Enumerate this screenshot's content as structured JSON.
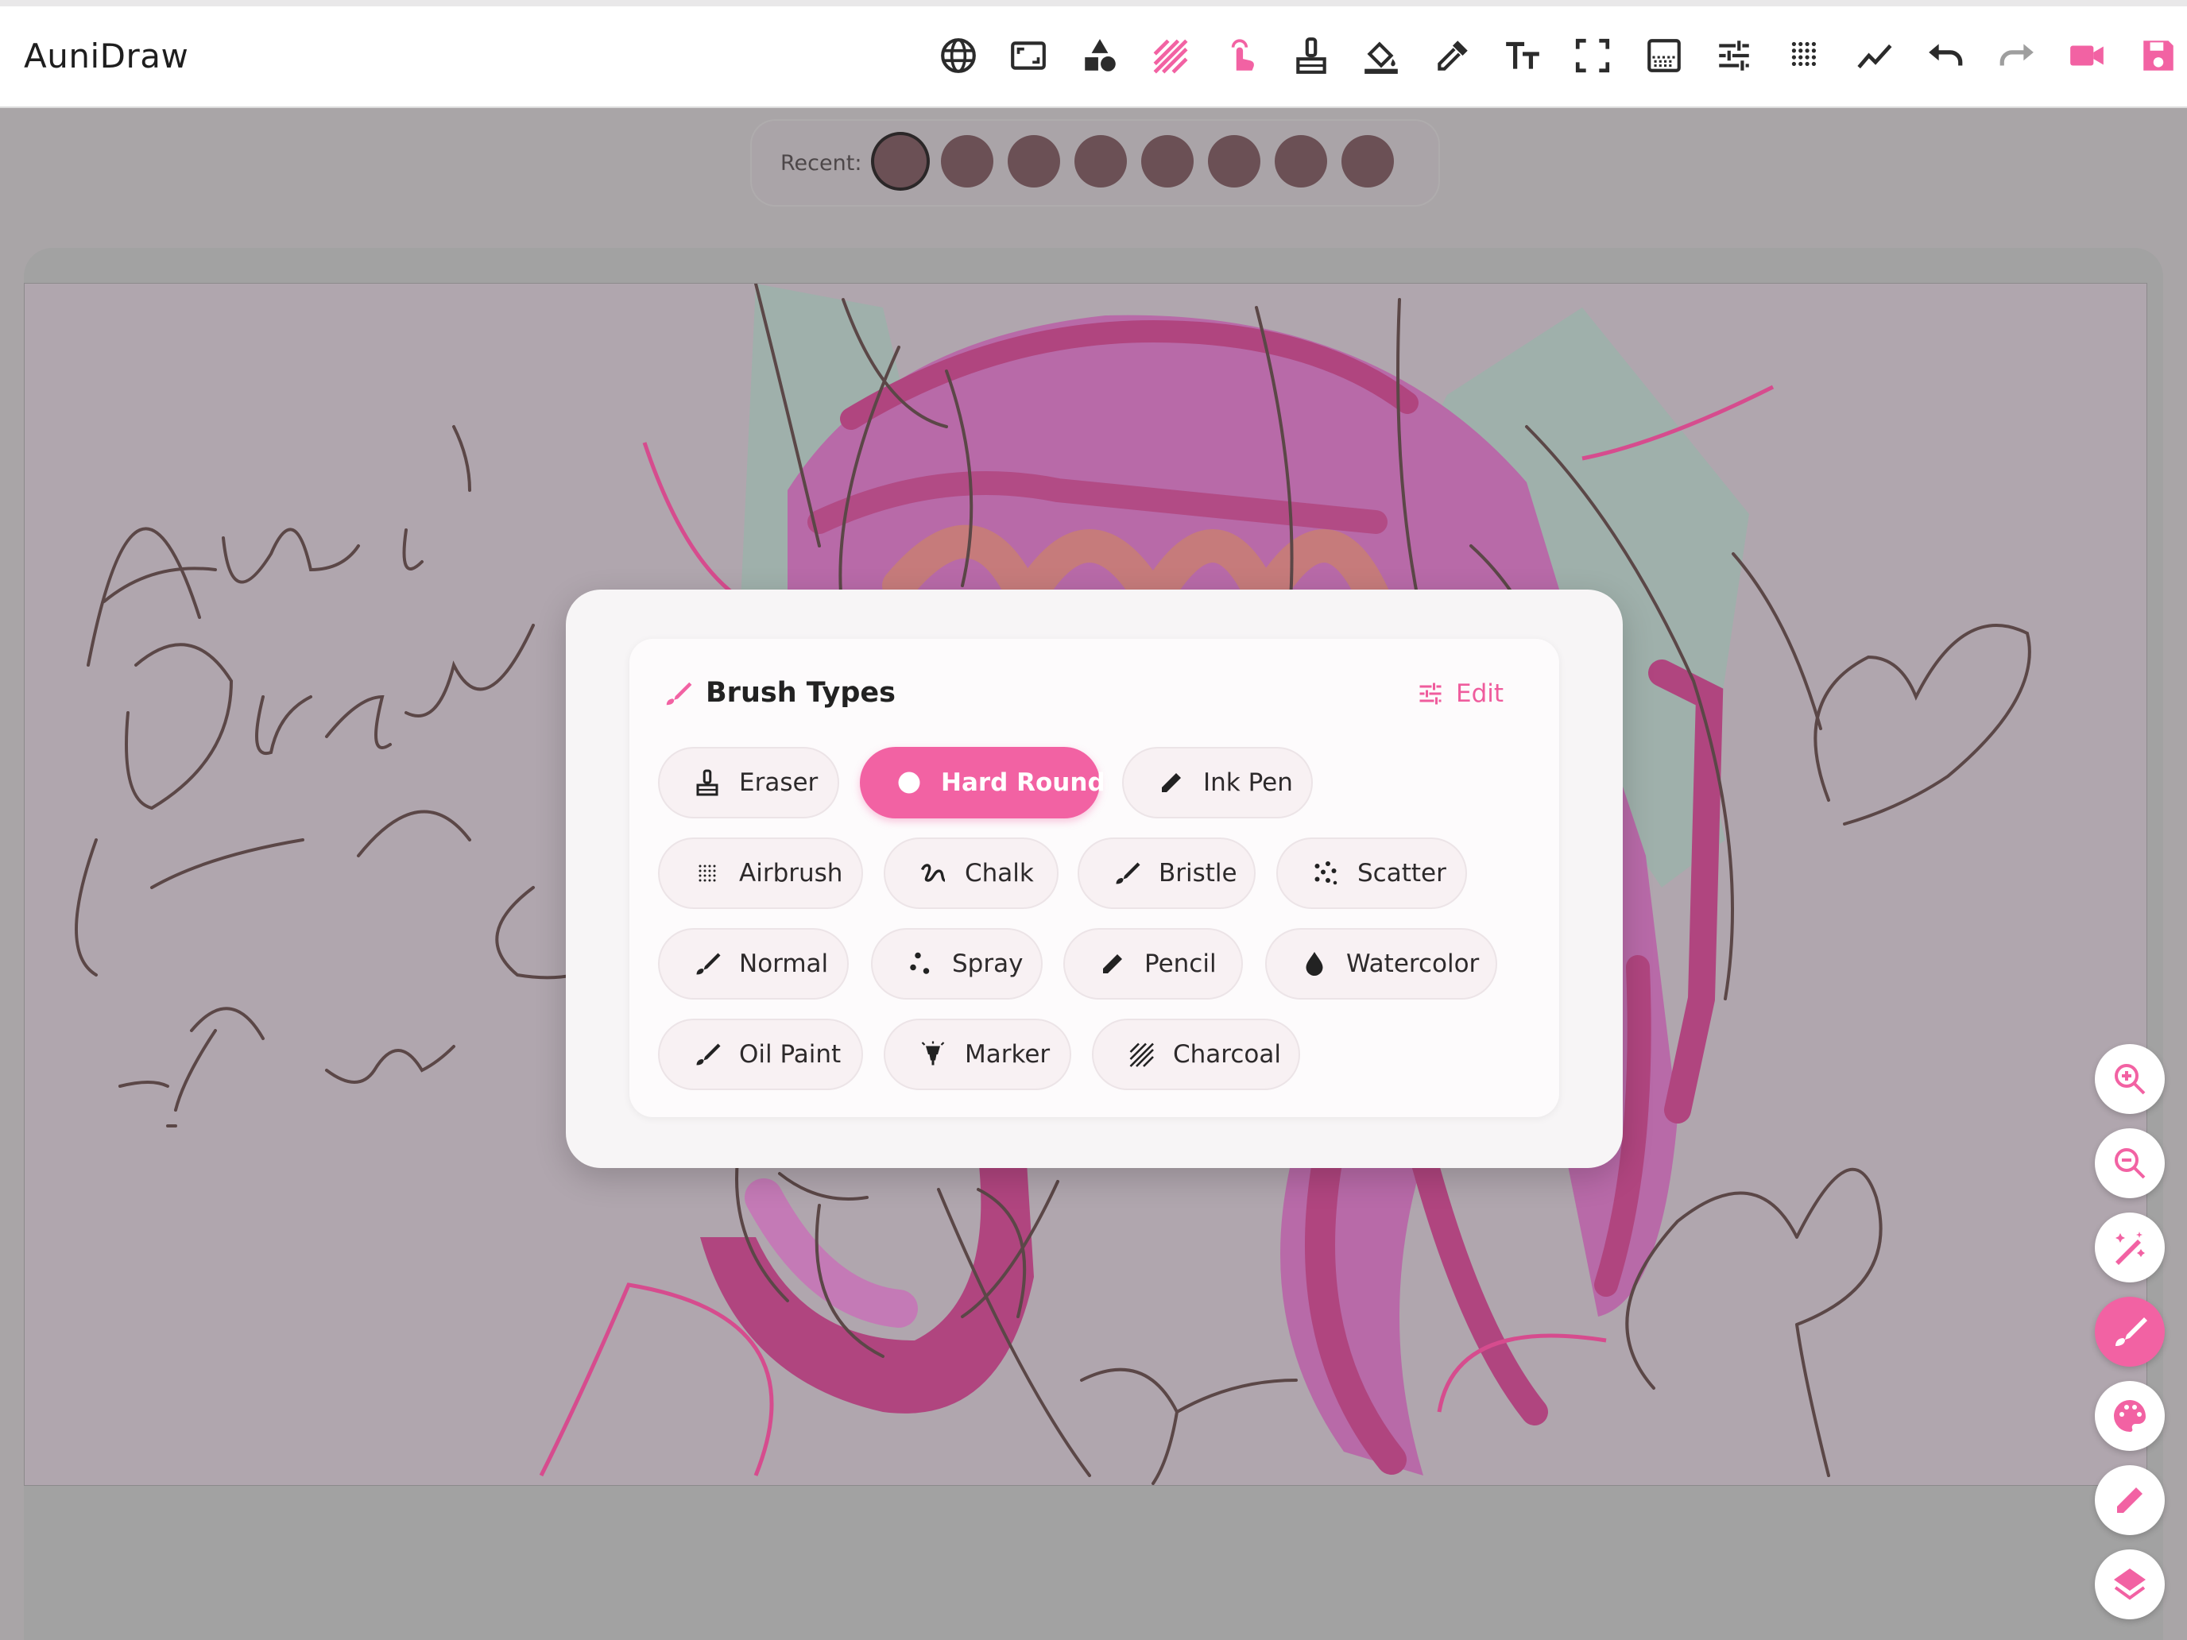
{
  "app": {
    "title": "AuniDraw"
  },
  "colors": {
    "accent": "#f262a3",
    "icon_dark": "#2b2b2b",
    "recent_swatch": "#6b5055",
    "canvas_bg": "#b0a6ae"
  },
  "toolbar": {
    "tools": [
      {
        "name": "language-globe-icon"
      },
      {
        "name": "canvas-size-icon"
      },
      {
        "name": "shapes-icon"
      },
      {
        "name": "texture-hatch-icon",
        "active": true
      },
      {
        "name": "touch-draw-icon",
        "active": true
      },
      {
        "name": "eraser-brush-icon"
      },
      {
        "name": "fill-bucket-icon"
      },
      {
        "name": "eyedropper-icon"
      },
      {
        "name": "text-size-icon"
      },
      {
        "name": "fullscreen-icon"
      },
      {
        "name": "gradient-icon"
      },
      {
        "name": "adjustments-icon"
      },
      {
        "name": "halftone-dots-icon"
      },
      {
        "name": "stroke-line-icon"
      },
      {
        "name": "undo-icon"
      },
      {
        "name": "redo-icon",
        "disabled": true
      },
      {
        "name": "record-video-icon",
        "active": true
      },
      {
        "name": "save-icon",
        "active": true
      }
    ]
  },
  "recent": {
    "label": "Recent:",
    "swatches": [
      "#6b5055",
      "#6b5055",
      "#6b5055",
      "#6b5055",
      "#6b5055",
      "#6b5055",
      "#6b5055",
      "#6b5055"
    ],
    "selected_index": 0
  },
  "brush_panel": {
    "title": "Brush Types",
    "edit_label": "Edit",
    "selected": "Hard Round",
    "rows": [
      [
        {
          "label": "Eraser",
          "icon": "eraser-icon"
        },
        {
          "label": "Hard Round",
          "icon": "circle-icon"
        },
        {
          "label": "Ink Pen",
          "icon": "pen-icon"
        }
      ],
      [
        {
          "label": "Airbrush",
          "icon": "airbrush-dots-icon"
        },
        {
          "label": "Chalk",
          "icon": "squiggle-icon"
        },
        {
          "label": "Bristle",
          "icon": "brush-icon"
        },
        {
          "label": "Scatter",
          "icon": "scatter-icon"
        }
      ],
      [
        {
          "label": "Normal",
          "icon": "brush-icon"
        },
        {
          "label": "Spray",
          "icon": "spray-dots-icon"
        },
        {
          "label": "Pencil",
          "icon": "pencil-icon"
        },
        {
          "label": "Watercolor",
          "icon": "drop-icon"
        }
      ],
      [
        {
          "label": "Oil Paint",
          "icon": "brush-icon"
        },
        {
          "label": "Marker",
          "icon": "marker-icon"
        },
        {
          "label": "Charcoal",
          "icon": "hatch-icon"
        }
      ]
    ]
  },
  "side_buttons": [
    {
      "name": "zoom-in-icon"
    },
    {
      "name": "zoom-out-icon"
    },
    {
      "name": "magic-wand-icon"
    },
    {
      "name": "brush-icon",
      "active": true
    },
    {
      "name": "palette-icon"
    },
    {
      "name": "pencil-icon"
    },
    {
      "name": "layers-icon"
    }
  ]
}
